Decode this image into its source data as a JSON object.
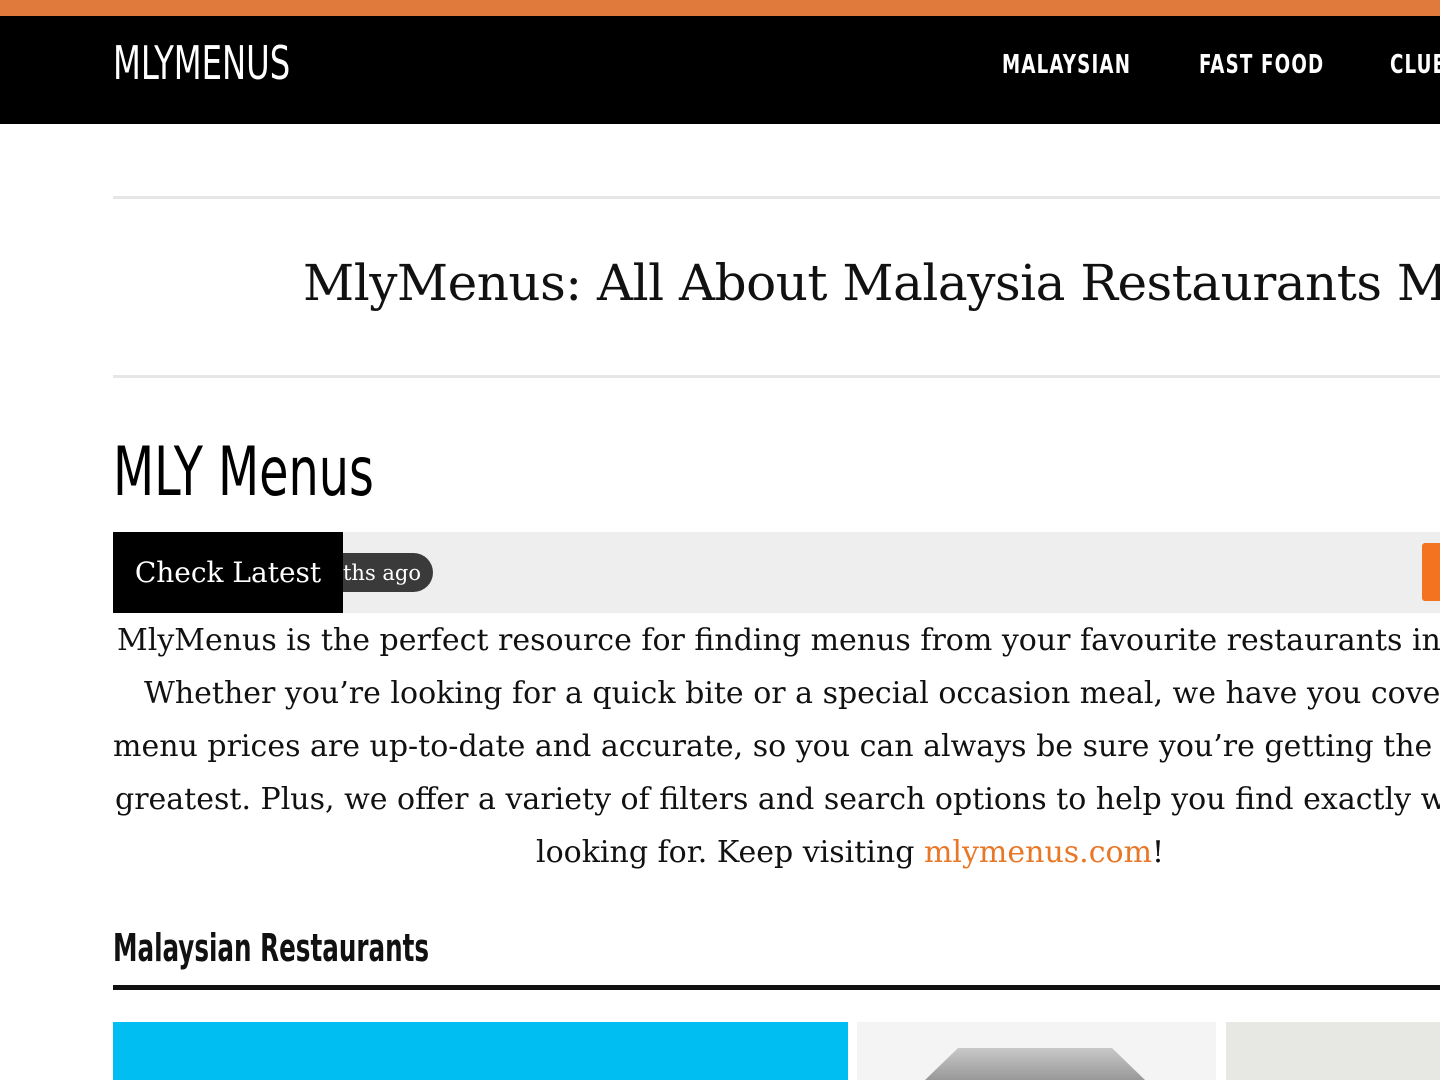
{
  "header": {
    "brand": "MLYMENUS",
    "nav": [
      "MALAYSIAN",
      "FAST FOOD",
      "CLUE"
    ]
  },
  "hero": {
    "tagline": "MlyMenus: All About Malaysia Restaurants Me"
  },
  "main": {
    "section_title": "MLY Menus",
    "ticker": {
      "label": "Check Latest",
      "time": "nths ago"
    },
    "intro": {
      "line1": "MlyMenus is the perfect resource for finding menus from your favourite restaurants in",
      "line2": "Whether you’re looking for a quick bite or a special occasion meal, we have you cover",
      "line3": "menu prices are up-to-date and accurate, so you can always be sure you’re getting the l",
      "line4": "greatest. Plus, we offer a variety of filters and search options to help you find exactly wh",
      "line5_pre": "looking for. Keep visiting ",
      "line5_link": "mlymenus.com",
      "line5_post": "!"
    },
    "category": {
      "title": "Malaysian Restaurants"
    }
  },
  "colors": {
    "accent": "#e07a3c",
    "link": "#e87728",
    "nav_bg": "#000000",
    "card_blue": "#00bdf2"
  }
}
